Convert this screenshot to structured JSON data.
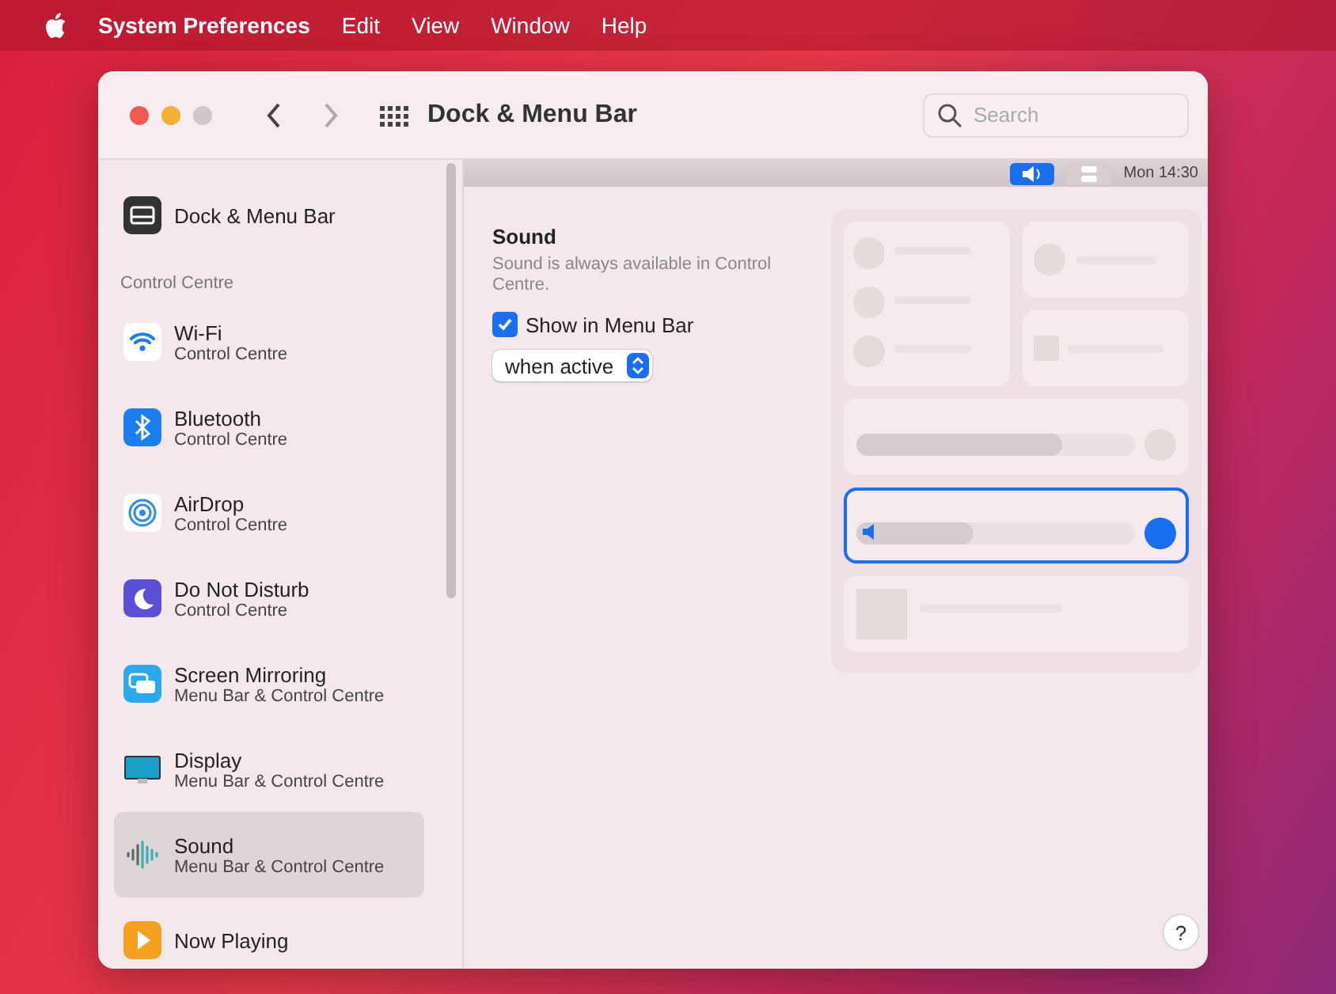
{
  "menu_bar": {
    "app": "System Preferences",
    "items": [
      "Edit",
      "View",
      "Window",
      "Help"
    ]
  },
  "window": {
    "title": "Dock & Menu Bar",
    "search": {
      "placeholder": "Search"
    }
  },
  "sidebar": {
    "top_item": {
      "title": "Dock & Menu Bar",
      "selected": false
    },
    "section": "Control Centre",
    "items": [
      {
        "title": "Wi-Fi",
        "subtitle": "Control Centre",
        "selected": false
      },
      {
        "title": "Bluetooth",
        "subtitle": "Control Centre",
        "selected": false
      },
      {
        "title": "AirDrop",
        "subtitle": "Control Centre",
        "selected": false
      },
      {
        "title": "Do Not Disturb",
        "subtitle": "Control Centre",
        "selected": false
      },
      {
        "title": "Screen Mirroring",
        "subtitle": "Menu Bar & Control Centre",
        "selected": false
      },
      {
        "title": "Display",
        "subtitle": "Menu Bar & Control Centre",
        "selected": false
      },
      {
        "title": "Sound",
        "subtitle": "Menu Bar & Control Centre",
        "selected": true
      },
      {
        "title": "Now Playing",
        "selected": false
      }
    ]
  },
  "detail": {
    "title": "Sound",
    "description": "Sound is always available in Control Centre.",
    "show_in_menu_bar": {
      "label": "Show in Menu Bar",
      "checked": true
    },
    "popup": {
      "value": "when active"
    },
    "preview_clock": "Mon 14:30",
    "preview_volume": {
      "level": 0.42
    },
    "help": "?"
  }
}
